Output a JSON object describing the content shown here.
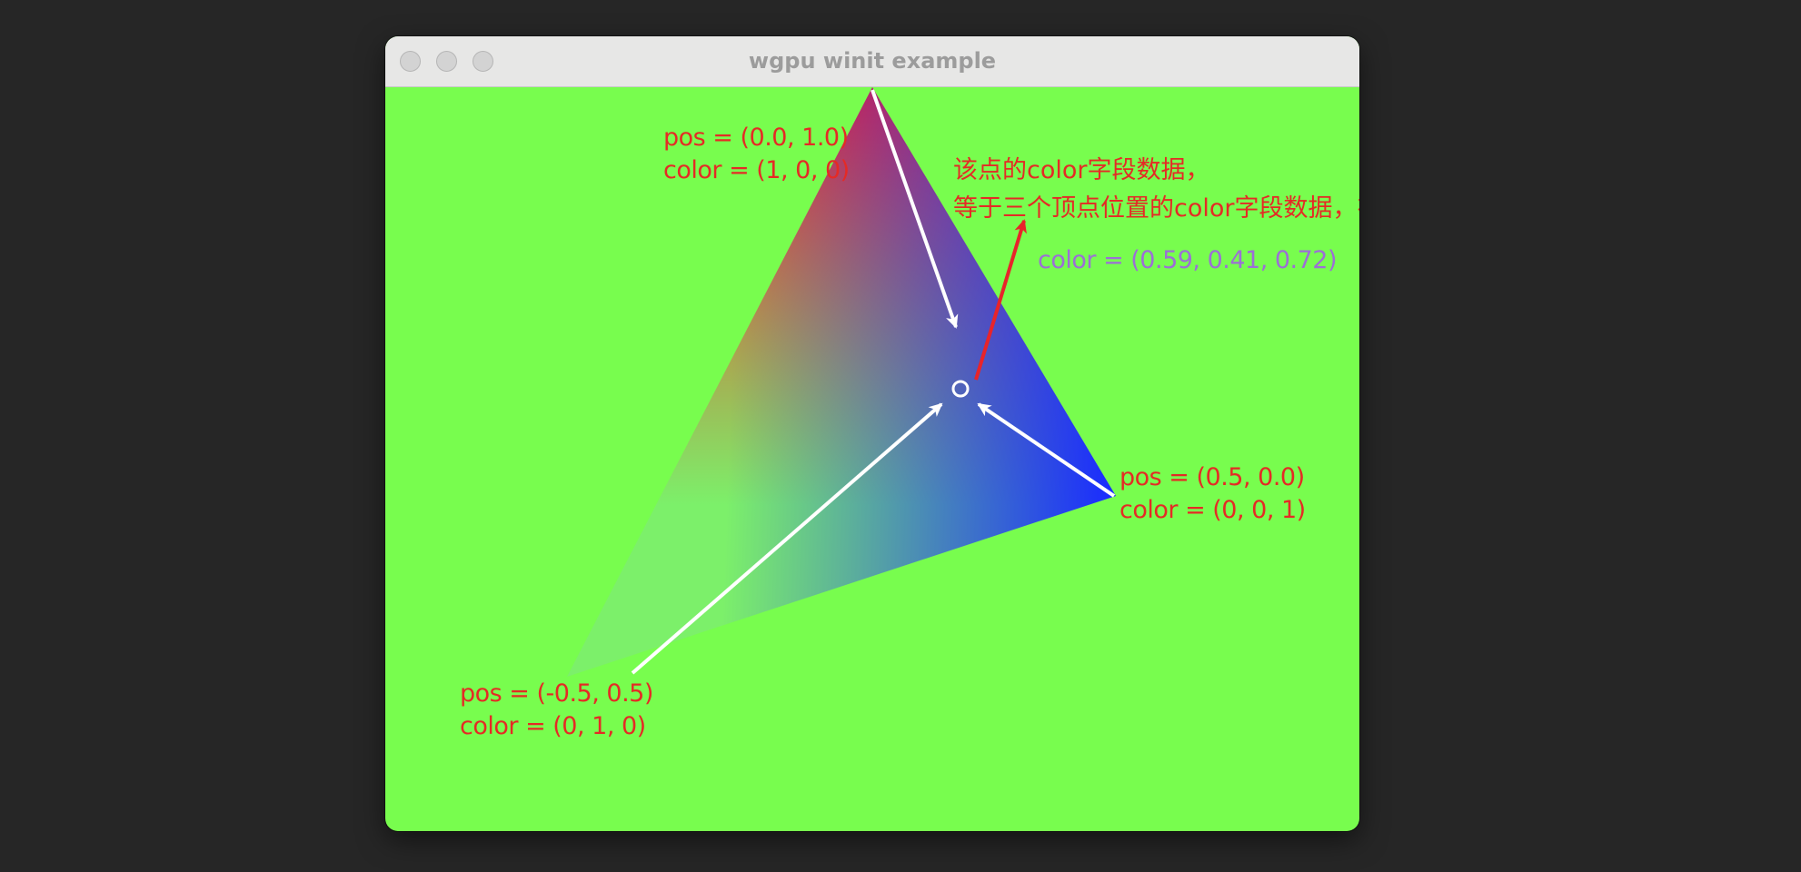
{
  "window": {
    "title": "wgpu winit example",
    "background_color": "#78fd4e"
  },
  "vertices": {
    "top": {
      "pos_text": "pos = (0.0, 1.0)",
      "color_text": "color = (1, 0, 0)",
      "color": "#ff2222"
    },
    "right": {
      "pos_text": "pos = (0.5,  0.0)",
      "color_text": "color = (0, 0, 1)",
      "color": "#1a2bff"
    },
    "left": {
      "pos_text": "pos = (-0.5, 0.5)",
      "color_text": "color = (0, 1, 0)",
      "color": "#7cf06a"
    }
  },
  "interpolated": {
    "color_text": "color = (0.59, 0.41, 0.72)",
    "color": "#9c6fd6"
  },
  "annotation": {
    "line1": "该点的color字段数据，",
    "line2": "等于三个顶点位置的color字段数据，在该处通过算法进行的叠加结果",
    "color": "#e52a25"
  }
}
